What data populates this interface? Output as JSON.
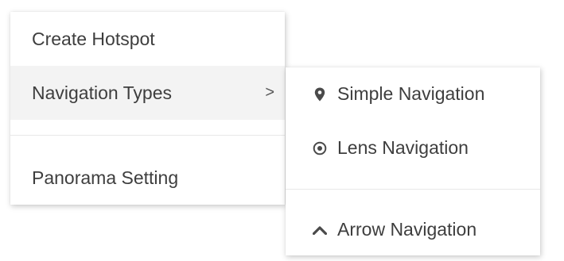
{
  "main_menu": {
    "items": [
      {
        "label": "Create Hotspot"
      },
      {
        "label": "Navigation Types",
        "chevron": ">"
      },
      {
        "label": "Panorama Setting"
      }
    ]
  },
  "sub_menu": {
    "items": [
      {
        "label": "Simple Navigation",
        "icon": "map-pin-icon"
      },
      {
        "label": "Lens Navigation",
        "icon": "target-circle-icon"
      },
      {
        "label": "Arrow Navigation",
        "icon": "chevron-up-icon"
      }
    ]
  },
  "colors": {
    "text": "#3e3e3e",
    "active_bg": "#f3f3f3",
    "divider": "#e8e8e8"
  }
}
